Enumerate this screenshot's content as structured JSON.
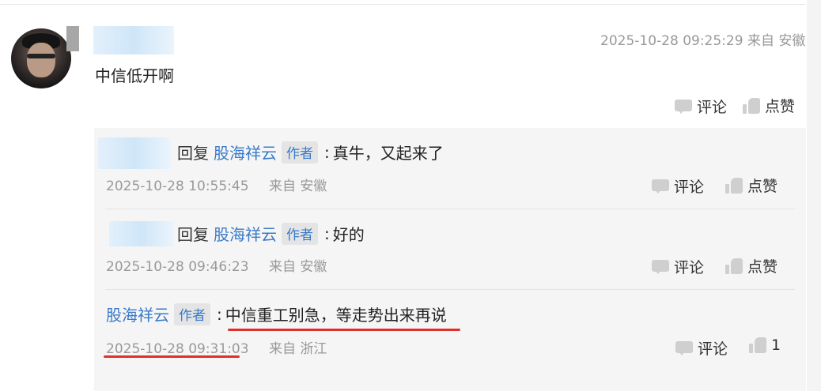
{
  "main_comment": {
    "timestamp": "2025-10-28 09:25:29",
    "location": "来自 安徽",
    "text": "中信低开啊",
    "comment_label": "评论",
    "like_label": "点赞"
  },
  "replies": [
    {
      "reply_word": "回复",
      "target": "股海祥云",
      "tag": "作者",
      "text": "真牛，又起来了",
      "timestamp": "2025-10-28 10:55:45",
      "location": "来自 安徽",
      "comment_label": "评论",
      "like_label": "点赞"
    },
    {
      "reply_word": "回复",
      "target": "股海祥云",
      "tag": "作者",
      "text": "好的",
      "timestamp": "2025-10-28 09:46:23",
      "location": "来自 安徽",
      "comment_label": "评论",
      "like_label": "点赞"
    },
    {
      "author": "股海祥云",
      "tag": "作者",
      "text": "中信重工别急，等走势出来再说",
      "timestamp": "2025-10-28 09:31:03",
      "location": "来自 浙江",
      "comment_label": "评论",
      "like_count": "1"
    }
  ],
  "colors": {
    "link": "#3a7ac8",
    "highlight_underline": "#e0302a",
    "meta_gray": "#999999",
    "panel_bg": "#f5f5f5"
  }
}
